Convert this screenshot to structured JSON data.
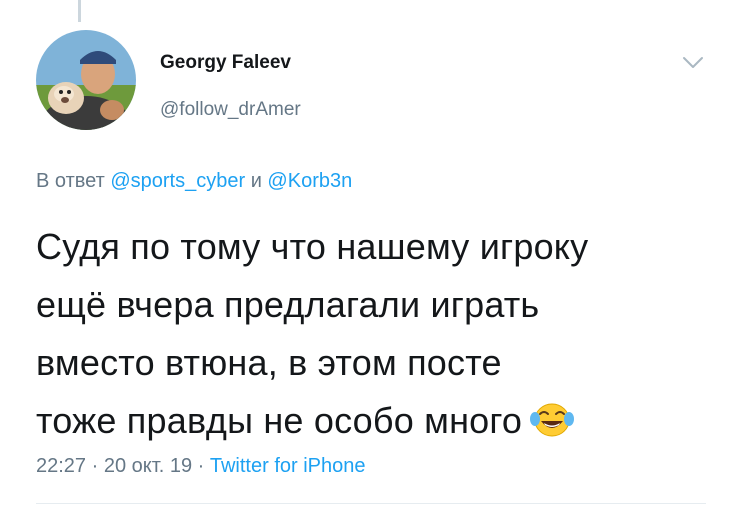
{
  "author": {
    "name": "Georgy Faleev",
    "handle": "@follow_drAmer"
  },
  "reply": {
    "prefix": "В ответ",
    "mention_1": "@sports_cyber",
    "joiner": "и",
    "mention_2": "@Korb3n"
  },
  "tweet": {
    "lines": [
      "Судя по тому что нашему игроку",
      "ещё вчера предлагали играть",
      "вместо втюна, в этом посте",
      "тоже правды не особо много"
    ],
    "emoji": "face-with-tears-of-joy"
  },
  "meta": {
    "time": "22:27",
    "date": "20 окт. 19",
    "separator": "·",
    "source": "Twitter for iPhone"
  },
  "icons": {
    "menu": "chevron-down-icon",
    "emoji": "face-with-tears-of-joy-icon"
  },
  "colors": {
    "text": "#14171a",
    "secondary": "#657786",
    "link": "#1da1f2"
  }
}
